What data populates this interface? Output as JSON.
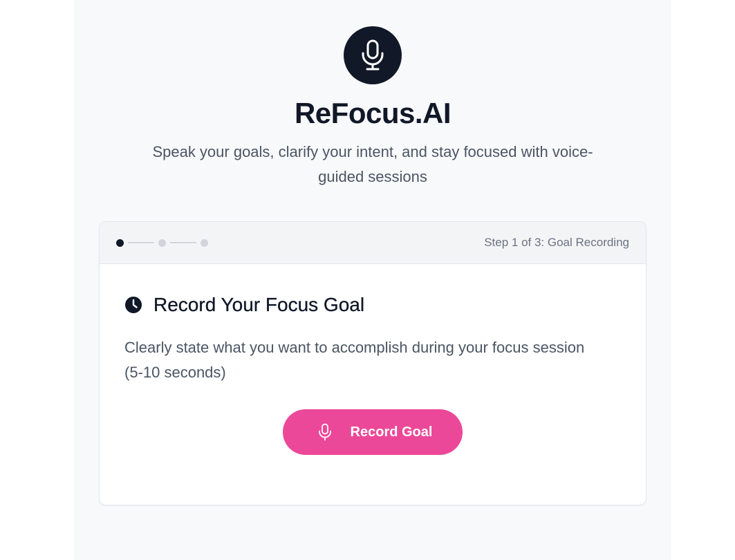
{
  "app": {
    "title": "ReFocus.AI",
    "tagline": "Speak your goals, clarify your intent, and stay focused with voice-guided sessions",
    "logo_icon": "microphone-icon"
  },
  "progress": {
    "current_step": 1,
    "total_steps": 3,
    "step_text": "Step 1 of 3: Goal Recording"
  },
  "card": {
    "title_icon": "clock-icon",
    "title": "Record Your Focus Goal",
    "description": "Clearly state what you want to accomplish during your focus session (5-10 seconds)",
    "button": {
      "icon": "microphone-icon",
      "label": "Record Goal"
    }
  },
  "colors": {
    "primary_dark": "#111827",
    "accent_pink": "#ec4899",
    "page_bg": "#f8f9fb",
    "muted_text": "#4b5563"
  }
}
